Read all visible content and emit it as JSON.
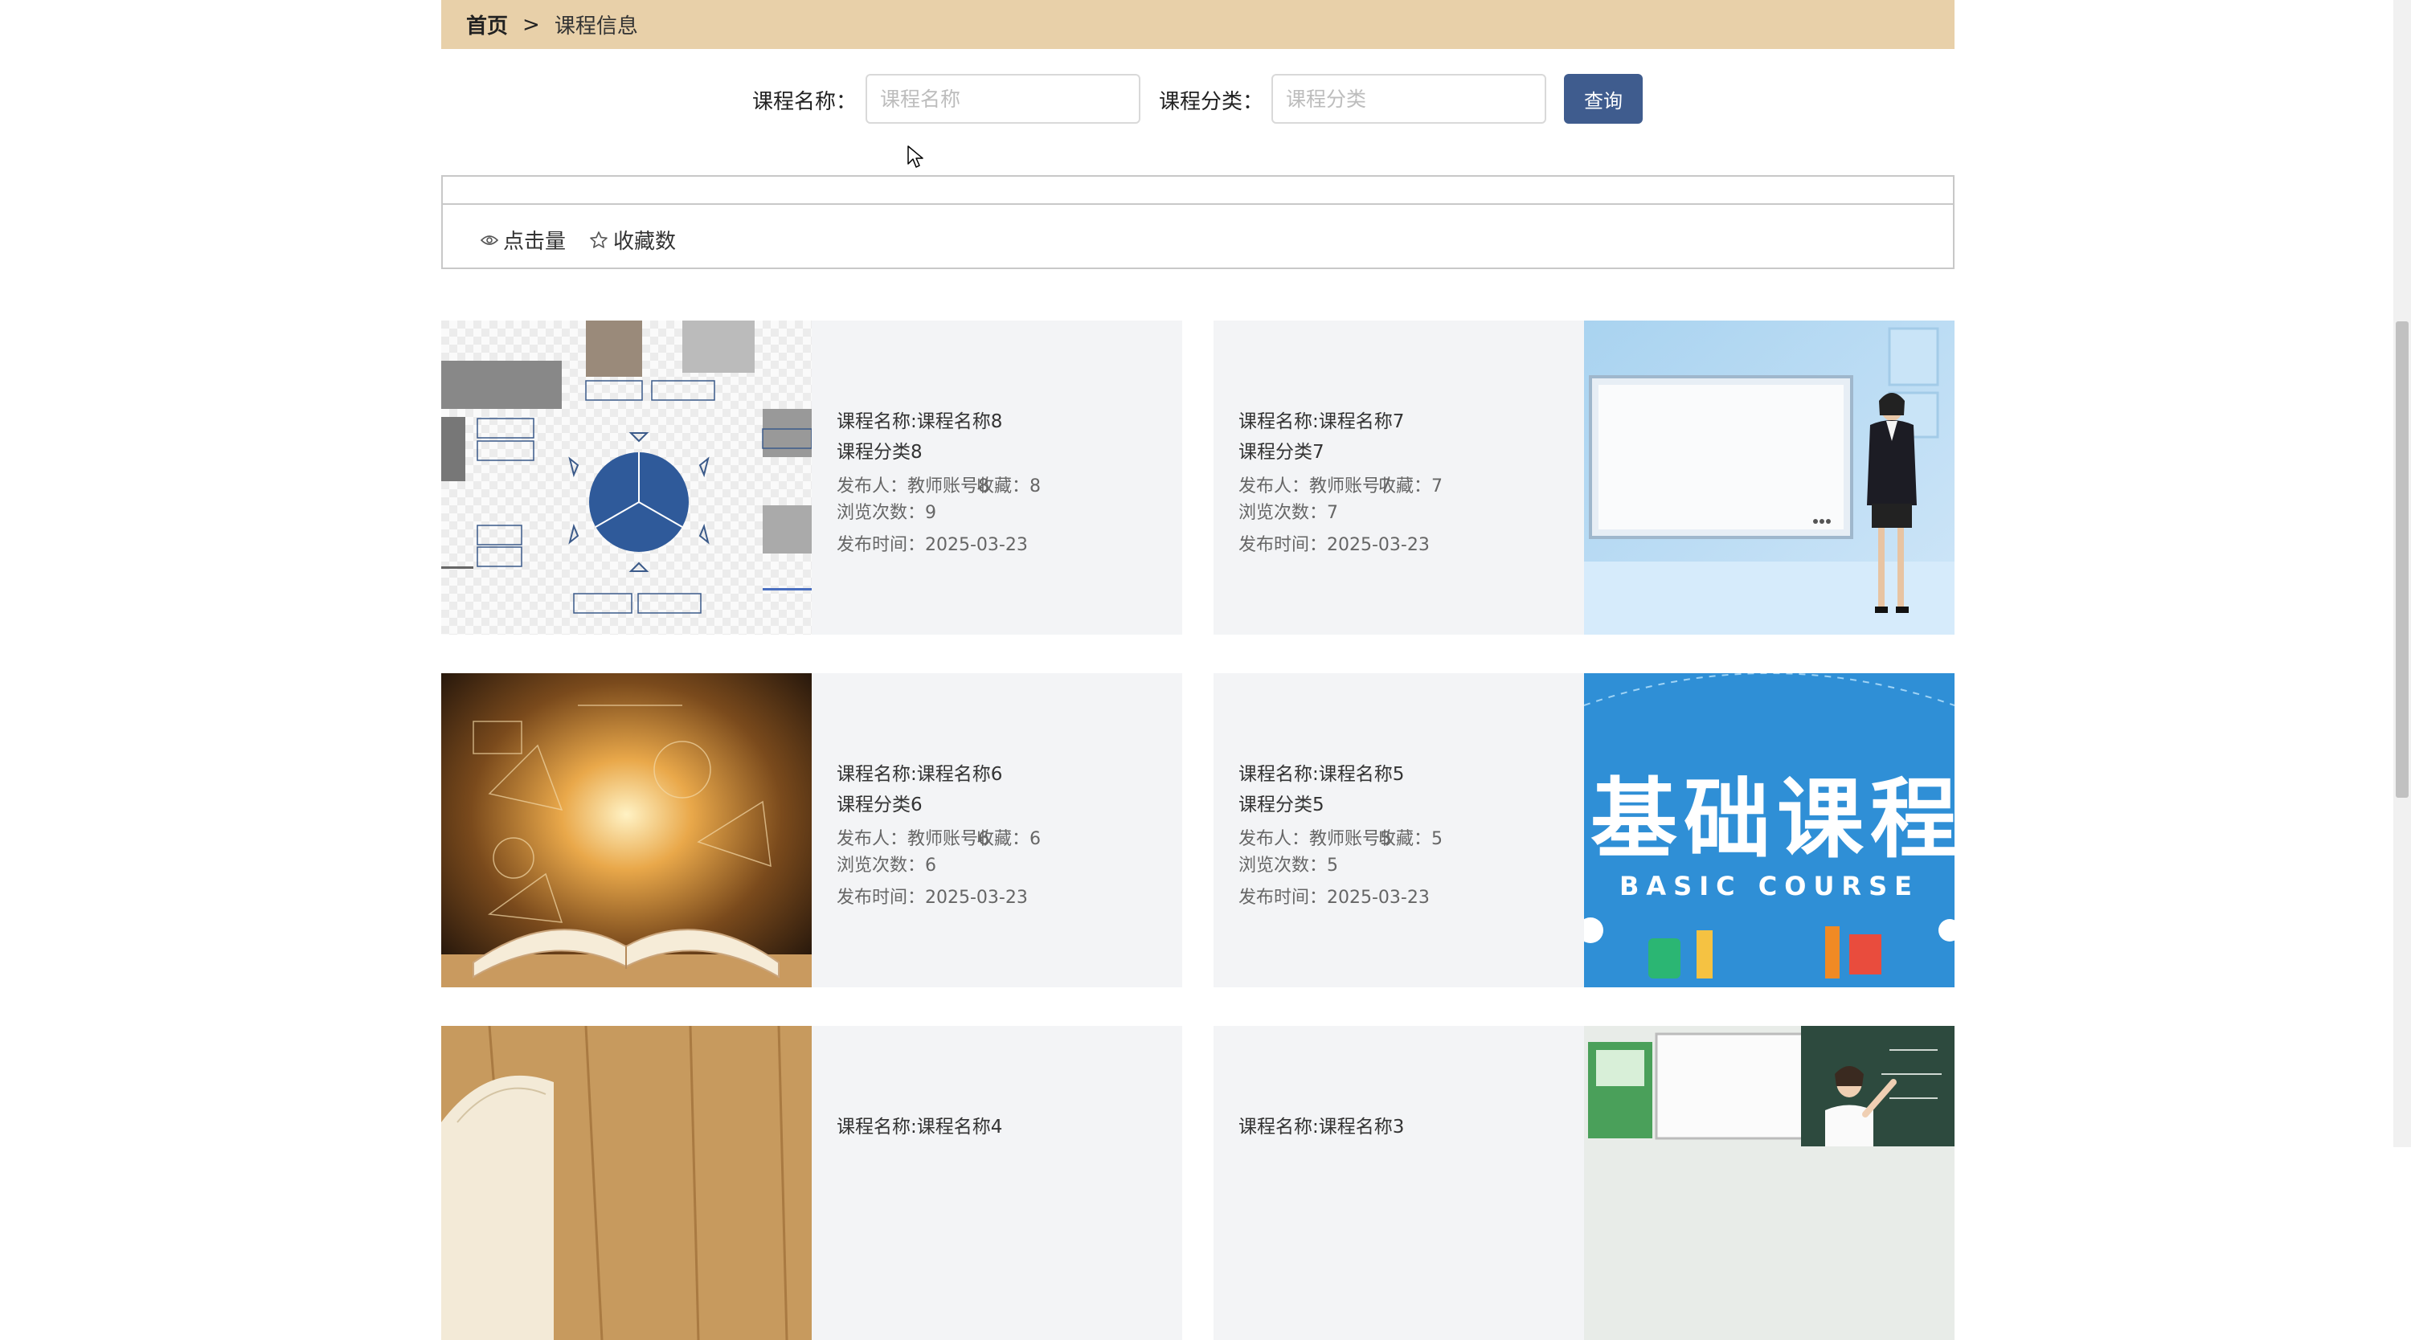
{
  "breadcrumb": {
    "home": "首页",
    "separator": ">",
    "current": "课程信息"
  },
  "search": {
    "name_label": "课程名称：",
    "name_placeholder": "课程名称",
    "category_label": "课程分类：",
    "category_placeholder": "课程分类",
    "query_button": "查询"
  },
  "sort": {
    "clicks_label": "点击量",
    "favorites_label": "收藏数"
  },
  "courses": [
    {
      "name": "课程名称:课程名称8",
      "category": "课程分类8",
      "publisher": "发布人：教师账号8",
      "favorites": "收藏：8",
      "views": "浏览次数：9",
      "time": "发布时间：2025-03-23",
      "image": "mind-map diagram"
    },
    {
      "name": "课程名称:课程名称7",
      "category": "课程分类7",
      "publisher": "发布人：教师账号7",
      "favorites": "收藏：7",
      "views": "浏览次数：7",
      "time": "发布时间：2025-03-23",
      "image": "presenter with screen"
    },
    {
      "name": "课程名称:课程名称6",
      "category": "课程分类6",
      "publisher": "发布人：教师账号6",
      "favorites": "收藏：6",
      "views": "浏览次数：6",
      "time": "发布时间：2025-03-23",
      "image": "open book with formulas"
    },
    {
      "name": "课程名称:课程名称5",
      "category": "课程分类5",
      "publisher": "发布人：教师账号5",
      "favorites": "收藏：5",
      "views": "浏览次数：5",
      "time": "发布时间：2025-03-23",
      "image": "basic course banner",
      "image_text_cn": "基础课程",
      "image_text_en": "BASIC COURSE"
    },
    {
      "name": "课程名称:课程名称4",
      "image": "book on wooden table"
    },
    {
      "name": "课程名称:课程名称3",
      "image": "teacher at blackboard"
    }
  ]
}
